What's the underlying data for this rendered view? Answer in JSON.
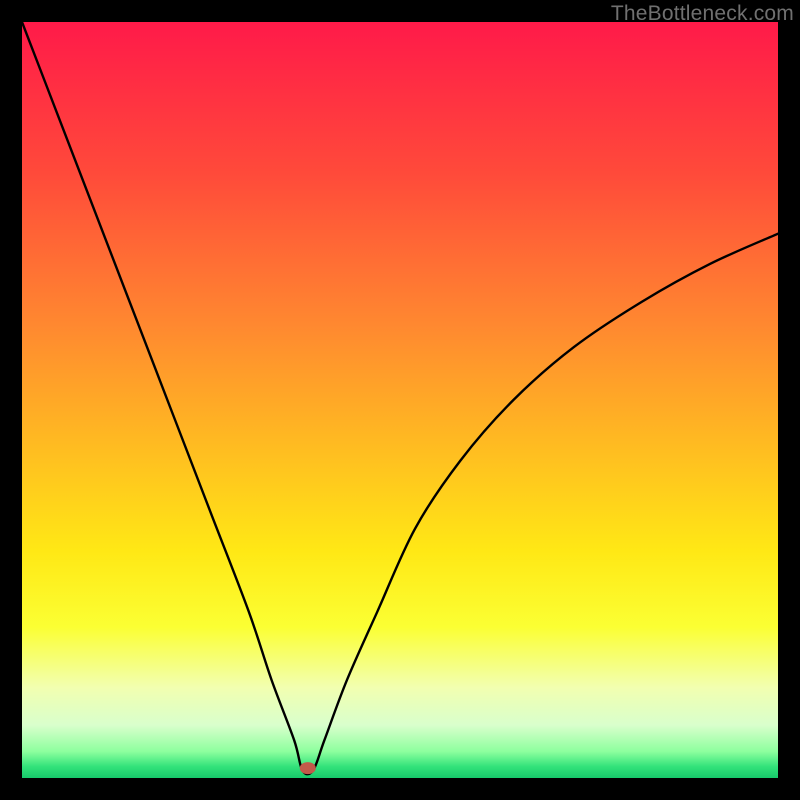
{
  "watermark": "TheBottleneck.com",
  "chart_data": {
    "type": "line",
    "title": "",
    "xlabel": "",
    "ylabel": "",
    "xlim": [
      0,
      100
    ],
    "ylim": [
      0,
      100
    ],
    "series": [
      {
        "name": "bottleneck-curve",
        "x": [
          0,
          5,
          10,
          15,
          20,
          25,
          30,
          33,
          36,
          37.1,
          38.5,
          40,
          43,
          47,
          52,
          58,
          65,
          73,
          82,
          91,
          100
        ],
        "values": [
          100,
          87,
          74,
          61,
          48,
          35,
          22,
          13,
          5,
          1,
          1,
          5,
          13,
          22,
          33,
          42,
          50,
          57,
          63,
          68,
          72
        ]
      }
    ],
    "marker": {
      "x": 37.8,
      "y": 1.3,
      "label": "optimal-point"
    },
    "gradient_stops": [
      {
        "offset": 0,
        "color": "#ff1a49"
      },
      {
        "offset": 0.2,
        "color": "#ff4a3a"
      },
      {
        "offset": 0.4,
        "color": "#ff8830"
      },
      {
        "offset": 0.55,
        "color": "#ffb822"
      },
      {
        "offset": 0.7,
        "color": "#ffe815"
      },
      {
        "offset": 0.8,
        "color": "#fbff33"
      },
      {
        "offset": 0.88,
        "color": "#f2ffb0"
      },
      {
        "offset": 0.93,
        "color": "#d9ffcc"
      },
      {
        "offset": 0.965,
        "color": "#8dff9e"
      },
      {
        "offset": 0.985,
        "color": "#32e27a"
      },
      {
        "offset": 1.0,
        "color": "#17c96b"
      }
    ],
    "marker_color": "#c25a4a"
  }
}
